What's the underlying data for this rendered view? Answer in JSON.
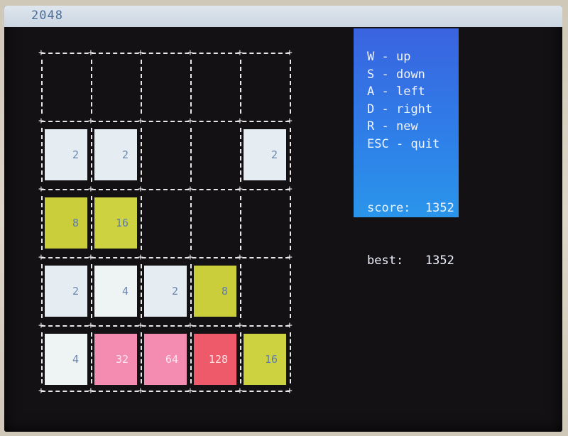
{
  "window": {
    "title": "2048"
  },
  "board": {
    "size": 4,
    "rows": [
      [
        null,
        null,
        null,
        null,
        null
      ],
      [
        2,
        2,
        null,
        null,
        2
      ],
      [
        8,
        16,
        null,
        null,
        null
      ],
      [
        2,
        4,
        2,
        8,
        null
      ],
      [
        4,
        32,
        64,
        128,
        16
      ]
    ]
  },
  "tile_colors": {
    "2": {
      "bg": "#e6edf2",
      "fg": "#6a86b0"
    },
    "4": {
      "bg": "#eef3f4",
      "fg": "#6a86b0"
    },
    "8": {
      "bg": "#c9ce3a",
      "fg": "#5d7bb0"
    },
    "16": {
      "bg": "#cdd240",
      "fg": "#5d7bb0"
    },
    "32": {
      "bg": "#f48cb2",
      "fg": "#fbe8f0"
    },
    "64": {
      "bg": "#f48cb2",
      "fg": "#fbe8f0"
    },
    "128": {
      "bg": "#ee5a6a",
      "fg": "#fde2e4"
    }
  },
  "controls": [
    {
      "key": "W",
      "action": "up"
    },
    {
      "key": "S",
      "action": "down"
    },
    {
      "key": "A",
      "action": "left"
    },
    {
      "key": "D",
      "action": "right"
    },
    {
      "key": "R",
      "action": "new"
    },
    {
      "key": "ESC",
      "action": "quit"
    }
  ],
  "score": {
    "label": "score:",
    "value": "1352"
  },
  "best": {
    "label": "best:",
    "value": "1352"
  }
}
